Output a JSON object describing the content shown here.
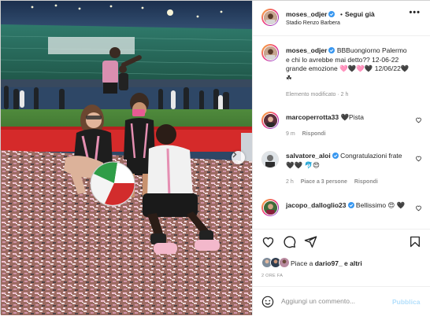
{
  "post": {
    "username": "moses_odjer",
    "follow_label": "Segui già",
    "location": "Stadio Renzo Barbera",
    "more_label": "•••"
  },
  "caption": {
    "username": "moses_odjer",
    "text": "BBBuongiorno Palermo e chi lo avrebbe mai detto?? 12-06-22 grande emozione 🩷🖤🩷🖤 12/06/22🖤☘",
    "edited": "Elemento modificato · 2 h"
  },
  "comments": [
    {
      "username": "marcoperrotta33",
      "text": "🖤Pista",
      "time": "9 m",
      "likes": "",
      "reply": "Rispondi"
    },
    {
      "username": "salvatore_aloi",
      "text": "Congratulazioni frate 🖤🖤 🐬😍",
      "time": "2 h",
      "likes": "Piace a 3 persone",
      "reply": "Rispondi"
    },
    {
      "username": "jacopo_dalloglio23",
      "text": "Bellissimo 😍 🖤",
      "time": "",
      "likes": "",
      "reply": ""
    }
  ],
  "actions": {
    "like_icon": "heart-outline-icon",
    "comment_icon": "comment-bubble-icon",
    "share_icon": "paper-plane-icon",
    "save_icon": "bookmark-icon"
  },
  "likes": {
    "prefix": "Piace a ",
    "user": "dario97_",
    "suffix": " e altri"
  },
  "date": "2 ORE FA",
  "add_comment": {
    "placeholder": "Aggiungi un commento...",
    "publish_label": "Pubblica"
  },
  "colors": {
    "verified": "#3897f0",
    "story_ring_start": "#f9ce34",
    "story_ring_end": "#6228d7",
    "publish_disabled": "#b2dffc",
    "muted_text": "#8e8e8e",
    "pink_heart": "#ed4956"
  }
}
